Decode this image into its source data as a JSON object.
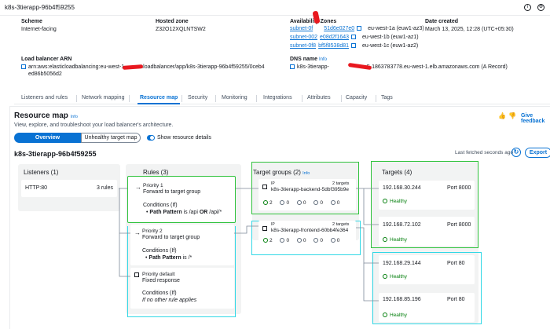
{
  "header": {
    "title": "k8s-3tierapp-96b4f59255"
  },
  "details": {
    "scheme_label": "Scheme",
    "scheme_value": "Internet-facing",
    "hosted_zone_label": "Hosted zone",
    "hosted_zone_value": "Z32O12XQLNTSW2",
    "az_label": "Availability Zones",
    "az_items": [
      {
        "subnet": "subnet-0f",
        "subnet_tail": "51d6e027e0",
        "zone": "eu-west-1a (euw1-az3)"
      },
      {
        "subnet": "subnet-002",
        "subnet_tail": "e08d2f1643",
        "zone": "eu-west-1b (euw1-az1)"
      },
      {
        "subnet": "subnet-0f8",
        "subnet_tail": "bf5f8538d81",
        "zone": "eu-west-1c (euw1-az2)"
      }
    ],
    "date_label": "Date created",
    "date_value": "March 13, 2025, 12:28 (UTC+05:30)",
    "arn_label": "Load balancer ARN",
    "arn_line1_start": "arn:aws:elasticloadbalancing:eu-west-1",
    "arn_line1_end": ":loadbalancer/app/k8s-3tierapp-96b4f59255/0ceb4",
    "arn_line2": "ed86b5056d2",
    "dns_label": "DNS name",
    "dns_info": "Info",
    "dns_start": "k8s-3tierapp-",
    "dns_end": "5-1863783778.eu-west-1.elb.amazonaws.com (A Record)"
  },
  "tabs": [
    "Listeners and rules",
    "Network mapping",
    "Resource map",
    "Security",
    "Monitoring",
    "Integrations",
    "Attributes",
    "Capacity",
    "Tags"
  ],
  "resource_map": {
    "title": "Resource map",
    "info": "Info",
    "subtitle": "View, explore, and troubleshoot your load balancer's architecture.",
    "feedback": "Give feedback",
    "overview": "Overview",
    "unhealthy": "Unhealthy target map",
    "show_details": "Show resource details",
    "lb_name": "k8s-3tierapp-96b4f59255",
    "last_fetched": "Last fetched seconds ago",
    "export": "Export"
  },
  "listeners": {
    "title": "Listeners (1)",
    "items": [
      {
        "name": "HTTP:80",
        "rules": "3 rules"
      }
    ]
  },
  "rules": {
    "title": "Rules (3)",
    "items": [
      {
        "priority": "Priority 1",
        "action": "Forward to target group",
        "cond_label": "Conditions (If)",
        "cond_key": "Path Pattern",
        "cond_text": " is /api ",
        "cond_or": "OR",
        "cond_tail": " /api/*"
      },
      {
        "priority": "Priority 2",
        "action": "Forward to target group",
        "cond_label": "Conditions (If)",
        "cond_key": "Path Pattern",
        "cond_text": " is /*"
      },
      {
        "priority": "Priority default",
        "action": "Fixed response",
        "cond_label": "Conditions (If)",
        "cond_text": "If no other rule applies"
      }
    ]
  },
  "target_groups": {
    "title": "Target groups (2)",
    "info": "Info",
    "items": [
      {
        "type": "IP",
        "name": "k8s-3tierapp-backend-5dbf395b9e",
        "count": "2 targets",
        "stats": [
          "2",
          "0",
          "0",
          "0",
          "0"
        ]
      },
      {
        "type": "IP",
        "name": "k8s-3tierapp-frontend-60bb4fe364",
        "count": "2 targets",
        "stats": [
          "2",
          "0",
          "0",
          "0",
          "0"
        ]
      }
    ]
  },
  "targets": {
    "title": "Targets (4)",
    "items": [
      {
        "ip": "192.168.30.244",
        "port": "Port 8000",
        "status": "Healthy"
      },
      {
        "ip": "192.168.72.102",
        "port": "Port 8000",
        "status": "Healthy"
      },
      {
        "ip": "192.168.29.144",
        "port": "Port 80",
        "status": "Healthy"
      },
      {
        "ip": "192.168.85.196",
        "port": "Port 80",
        "status": "Healthy"
      }
    ]
  }
}
